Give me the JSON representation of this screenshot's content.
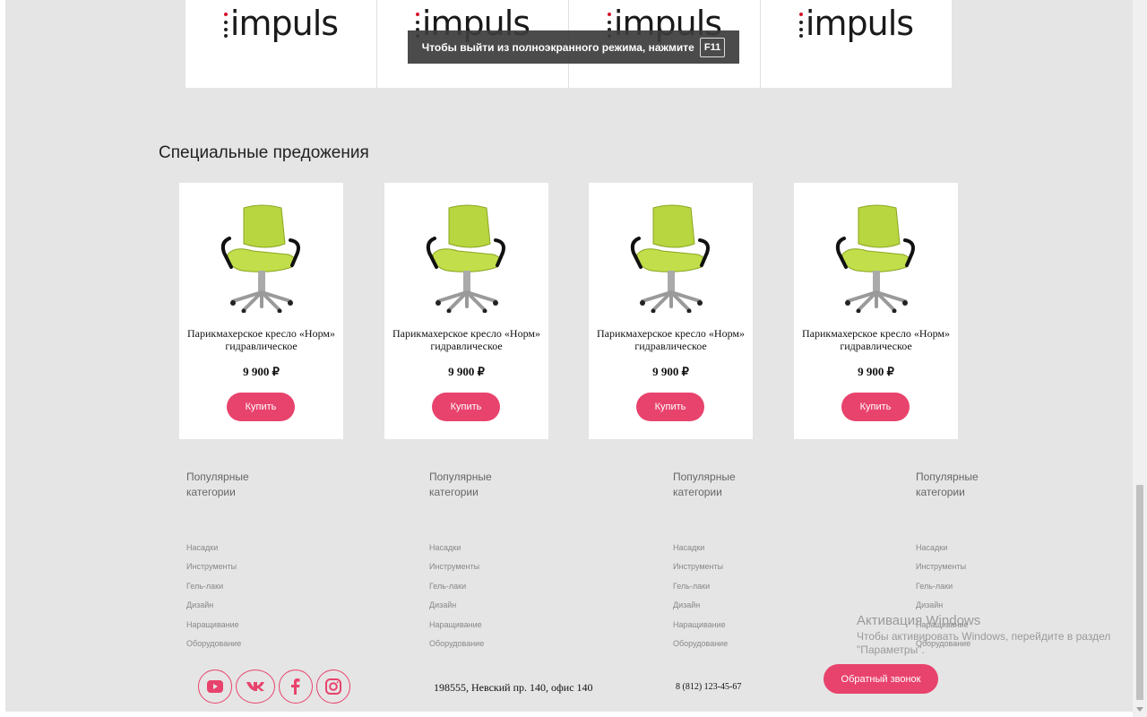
{
  "brands": [
    {
      "name": "impuls"
    },
    {
      "name": "impuls"
    },
    {
      "name": "impuls"
    },
    {
      "name": "impuls"
    }
  ],
  "fullscreen_toast": {
    "text": "Чтобы выйти из полноэкранного режима, нажмите",
    "key": "F11"
  },
  "special_offers": {
    "title": "Специальные предожения",
    "products": [
      {
        "title": "Парикмахерское кресло «Норм» гидравлическое",
        "price": "9 900 ₽",
        "buy_label": "Купить",
        "image": "chair-image"
      },
      {
        "title": "Парикмахерское кресло «Норм» гидравлическое",
        "price": "9 900 ₽",
        "buy_label": "Купить",
        "image": "chair-image"
      },
      {
        "title": "Парикмахерское кресло «Норм» гидравлическое",
        "price": "9 900 ₽",
        "buy_label": "Купить",
        "image": "chair-image"
      },
      {
        "title": "Парикмахерское кресло «Норм» гидравлическое",
        "price": "9 900 ₽",
        "buy_label": "Купить",
        "image": "chair-image"
      }
    ]
  },
  "footer": {
    "columns": [
      {
        "title": "Популярные категории",
        "links": [
          "Насадки",
          "Инструменты",
          "Гель-лаки",
          "Дизайн",
          "Наращивание",
          "Оборудование"
        ]
      },
      {
        "title": "Популярные категории",
        "links": [
          "Насадки",
          "Инструменты",
          "Гель-лаки",
          "Дизайн",
          "Наращивание",
          "Оборудование"
        ]
      },
      {
        "title": "Популярные категории",
        "links": [
          "Насадки",
          "Инструменты",
          "Гель-лаки",
          "Дизайн",
          "Наращивание",
          "Оборудование"
        ]
      },
      {
        "title": "Популярные категории",
        "links": [
          "Насадки",
          "Инструменты",
          "Гель-лаки",
          "Дизайн",
          "Наращивание",
          "Оборудование"
        ]
      }
    ],
    "social": [
      "youtube-icon",
      "vk-icon",
      "facebook-icon",
      "instagram-icon"
    ],
    "address": "198555, Невский пр. 140, офис 140",
    "phone": "8 (812) 123-45-67",
    "callback_label": "Обратный звонок"
  },
  "windows_watermark": {
    "line1": "Активация Windows",
    "line2": "Чтобы активировать Windows, перейдите в раздел \"Параметры\"."
  },
  "colors": {
    "accent": "#e8436d",
    "page_bg": "#e5e5e5",
    "card_bg": "#ffffff"
  }
}
